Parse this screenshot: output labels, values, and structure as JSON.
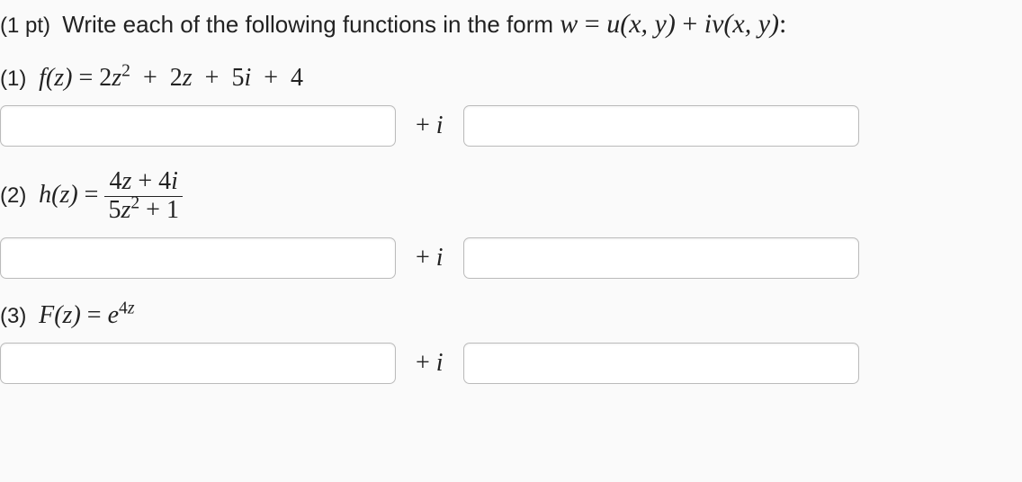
{
  "intro": {
    "points": "(1 pt)",
    "text_a": "Write each of the following functions in the form ",
    "w": "w",
    "eq": "  =  ",
    "uxy": "u(x, y)",
    "plus": "  +  ",
    "i": "i",
    "vxy": "v(x, y)",
    "colon": ":"
  },
  "parts": {
    "p1": {
      "label": "(1)",
      "func": "f(z)",
      "eq": "  =  ",
      "expr": "2z²  +  2z  +  5i  +  4"
    },
    "p2": {
      "label": "(2)",
      "func": "h(z)",
      "eq": "  =  ",
      "num": "4z  +  4i",
      "den": "5z²  +  1"
    },
    "p3": {
      "label": "(3)",
      "func": "F(z)",
      "eq": "  =  ",
      "base": "e",
      "exp": "4z"
    }
  },
  "sep": {
    "plus": "+ ",
    "i": "i"
  }
}
